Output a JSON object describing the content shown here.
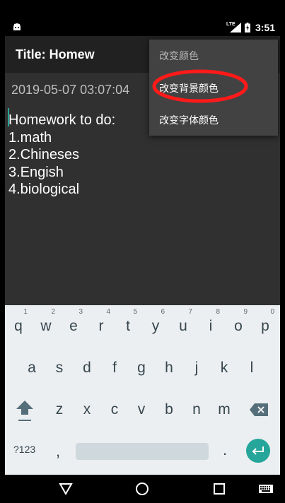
{
  "status_bar": {
    "network": "LTE",
    "time": "3:51"
  },
  "app_bar": {
    "title": "Title: Homew"
  },
  "note": {
    "date": "2019-05-07 03:07:04",
    "lines": [
      "Homework to do:",
      "1.math",
      "2.Chineses",
      "3.Engish",
      "4.biological"
    ]
  },
  "menu": {
    "header": "改变颜色",
    "items": [
      "改变背景颜色",
      "改变字体颜色"
    ]
  },
  "keyboard": {
    "row1": [
      {
        "key": "q",
        "num": "1"
      },
      {
        "key": "w",
        "num": "2"
      },
      {
        "key": "e",
        "num": "3"
      },
      {
        "key": "r",
        "num": "4"
      },
      {
        "key": "t",
        "num": "5"
      },
      {
        "key": "y",
        "num": "6"
      },
      {
        "key": "u",
        "num": "7"
      },
      {
        "key": "i",
        "num": "8"
      },
      {
        "key": "o",
        "num": "9"
      },
      {
        "key": "p",
        "num": "0"
      }
    ],
    "row2": [
      "a",
      "s",
      "d",
      "f",
      "g",
      "h",
      "j",
      "k",
      "l"
    ],
    "row3": [
      "z",
      "x",
      "c",
      "v",
      "b",
      "n",
      "m"
    ],
    "symbols_label": "?123",
    "comma": ",",
    "period": "."
  },
  "colors": {
    "accent": "#26a69a",
    "highlight_ring": "#ff1a1a",
    "background": "#303030",
    "appbar": "#212121",
    "menu": "#424242",
    "keyboard": "#eceff1"
  }
}
